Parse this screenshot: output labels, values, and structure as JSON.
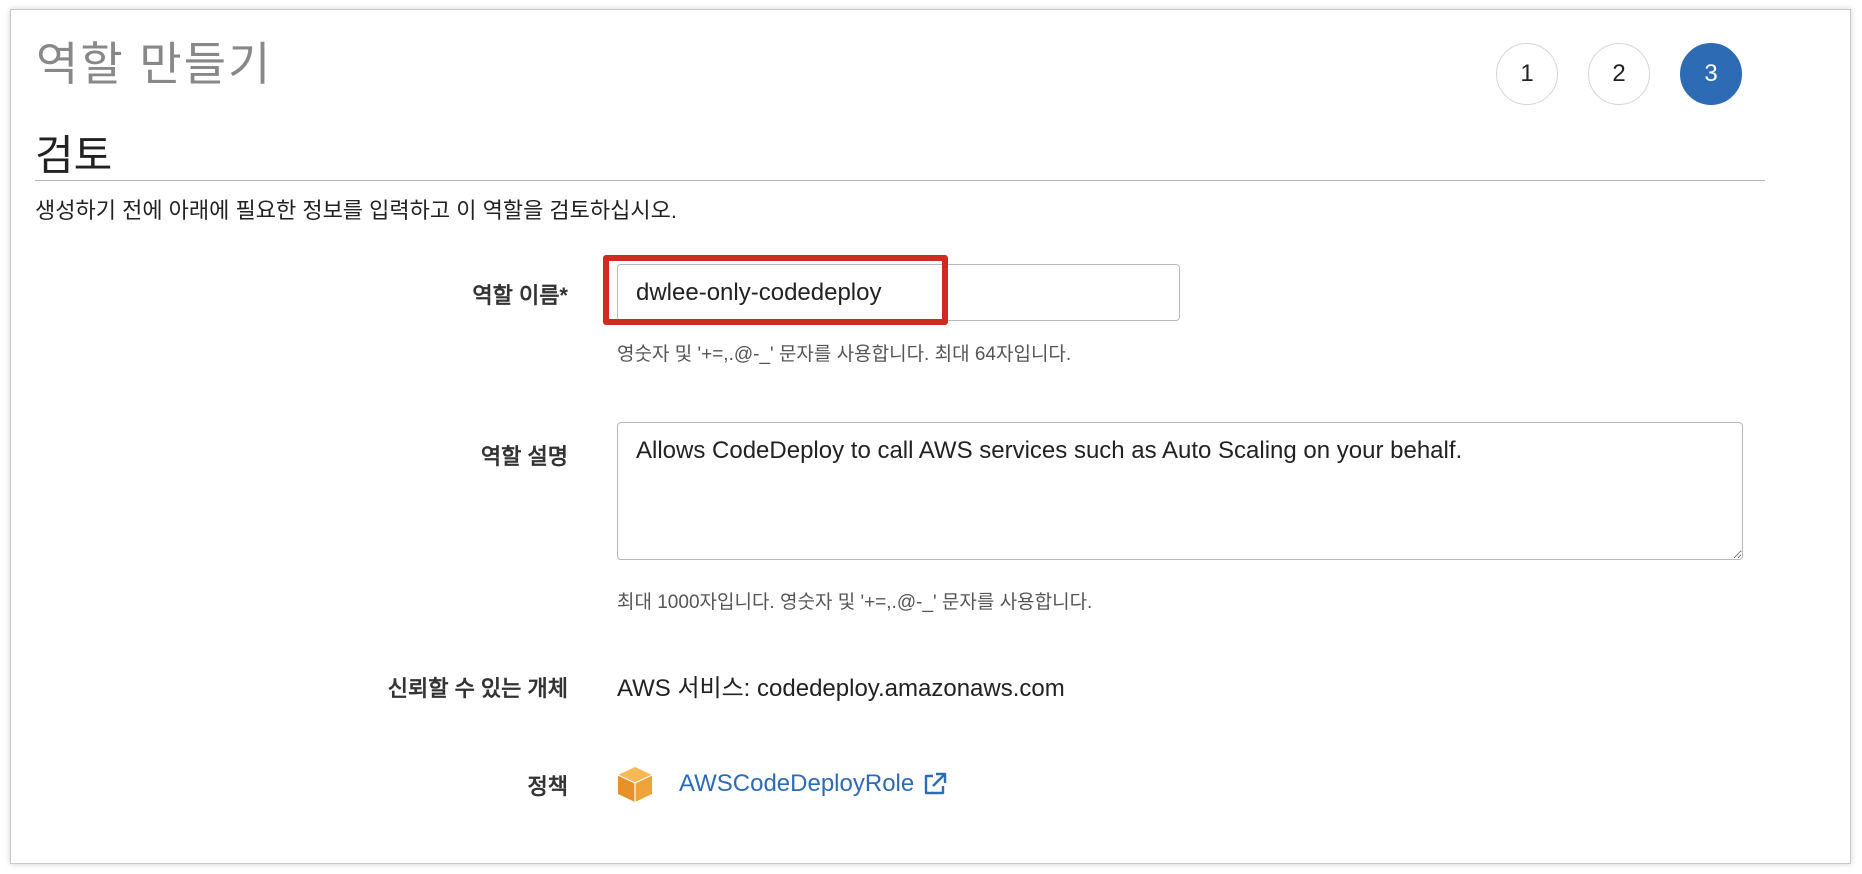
{
  "page": {
    "title": "역할 만들기",
    "section_title": "검토",
    "intro": "생성하기 전에 아래에 필요한 정보를 입력하고 이 역할을 검토하십시오."
  },
  "steps": [
    {
      "label": "1",
      "active": false
    },
    {
      "label": "2",
      "active": false
    },
    {
      "label": "3",
      "active": true
    }
  ],
  "form": {
    "role_name_label": "역할 이름*",
    "role_name_value": "dwlee-only-codedeploy",
    "role_name_hint": "영숫자 및 '+=,.@-_' 문자를 사용합니다. 최대 64자입니다.",
    "description_label": "역할 설명",
    "description_value": "Allows CodeDeploy to call AWS services such as Auto Scaling on your behalf.",
    "description_hint": "최대 1000자입니다. 영숫자 및 '+=,.@-_' 문자를 사용합니다.",
    "trusted_entity_label": "신뢰할 수 있는 개체",
    "trusted_entity_value": "AWS 서비스: codedeploy.amazonaws.com",
    "policy_label": "정책",
    "policy_name": "AWSCodeDeployRole"
  },
  "icons": {
    "policy_icon": "aws-box-icon",
    "external_link_icon": "external-link-icon"
  },
  "colors": {
    "accent": "#2e6bb5",
    "highlight": "#d12a20",
    "box_icon": "#f1a33b"
  }
}
